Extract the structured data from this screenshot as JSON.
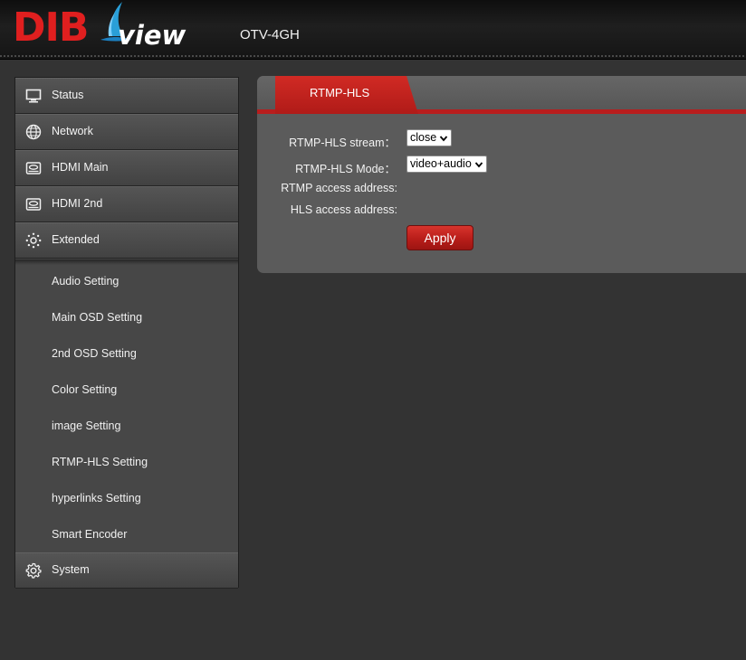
{
  "header": {
    "logo_text_1": "DIB",
    "logo_text_2": "view",
    "model": "OTV-4GH"
  },
  "sidebar": {
    "items": [
      {
        "label": "Status",
        "icon": "monitor-icon"
      },
      {
        "label": "Network",
        "icon": "globe-icon"
      },
      {
        "label": "HDMI Main",
        "icon": "hdmi-device-icon"
      },
      {
        "label": "HDMI 2nd",
        "icon": "hdmi-device-icon"
      },
      {
        "label": "Extended",
        "icon": "gear-dots-icon"
      },
      {
        "label": "System",
        "icon": "cog-icon"
      }
    ],
    "extended_submenu": [
      "Audio Setting",
      "Main OSD Setting",
      "2nd OSD Setting",
      "Color Setting",
      "image Setting",
      "RTMP-HLS Setting",
      "hyperlinks Setting",
      "Smart Encoder"
    ]
  },
  "panel": {
    "tab_label": "RTMP-HLS",
    "stream_label": "RTMP-HLS stream：",
    "stream_value": "close",
    "mode_label": "RTMP-HLS Mode：",
    "mode_value": "video+audio",
    "rtmp_address_label": "RTMP access address:",
    "hls_address_label": "HLS access address:",
    "apply_label": "Apply"
  },
  "colors": {
    "accent_red": "#c2221d",
    "background": "#333333",
    "panel": "#5b5b5b",
    "sidebar": "#454545"
  }
}
